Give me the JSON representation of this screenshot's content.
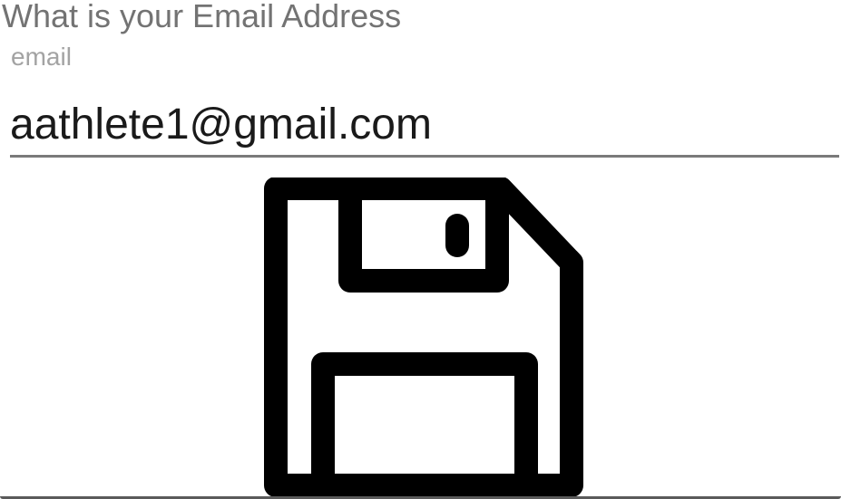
{
  "form": {
    "question": "What is your Email Address",
    "field_label": "email",
    "email_value": "aathlete1@gmail.com"
  },
  "actions": {
    "save_icon": "floppy-disk-save-icon"
  }
}
